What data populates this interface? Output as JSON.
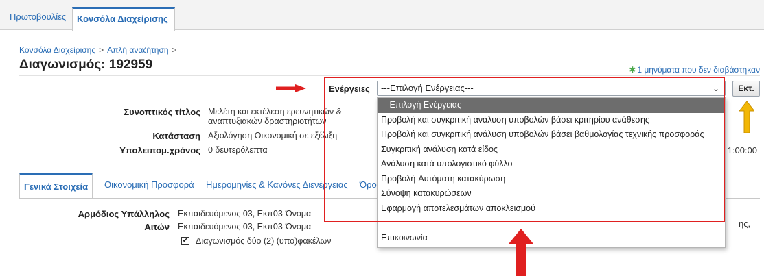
{
  "top_tabs": [
    "Πρωτοβουλίες",
    "Κονσόλα Διαχείρισης"
  ],
  "breadcrumb": [
    "Κονσόλα Διαχείρισης",
    "Απλή αναζήτηση"
  ],
  "breadcrumb_sep": ">",
  "page_title": "Διαγωνισμός: 192959",
  "messages_link": "1 μηνύματα που δεν διαβάστηκαν",
  "actions": {
    "label": "Ενέργειες",
    "selected": "---Επιλογή Ενέργειας---",
    "exec_button": "Εκτ.",
    "options": [
      "---Επιλογή Ενέργειας---",
      "Προβολή και συγκριτική ανάλυση υποβολών βάσει κριτηρίου ανάθεσης",
      "Προβολή και συγκριτική ανάλυση υποβολών βάσει βαθμολογίας τεχνικής προσφοράς",
      "Συγκριτική ανάλυση κατά είδος",
      "Ανάλυση κατά υπολογιστικό φύλλο",
      "Προβολή-Αυτόματη κατακύρωση",
      "Σύνοψη κατακυρώσεων",
      "Εφαρμογή αποτελεσμάτων αποκλεισμού",
      "--------------------",
      "Επικοινωνία"
    ]
  },
  "summary": {
    "title_label": "Συνοπτικός τίτλος",
    "title_value": "Μελέτη και εκτέλεση ερευνητικών & αναπτυξιακών δραστηριοτήτων",
    "status_label": "Κατάσταση",
    "status_value": "Αξιολόγηση Οικονομική σε εξέλιξη",
    "remaining_label": "Υπολειπομ.χρόνος",
    "remaining_value": "0 δευτερόλεπτα",
    "time_right": "11:00:00"
  },
  "tabs": [
    "Γενικά Στοιχεία",
    "Οικονομική Προσφορά",
    "Ημερομηνίες & Κανόνες Διενέργειας",
    "Όρο"
  ],
  "general": {
    "officer_label": "Αρμόδιος Υπάλληλος",
    "officer_value": "Εκπαιδευόμενος 03, Εκπ03-Όνομα",
    "requester_label": "Αιτών",
    "requester_value": "Εκπαιδευόμενος 03, Εκπ03-Όνομα",
    "checkbox_label": "Διαγωνισμός δύο (2) (υπο)φακέλων",
    "checkbox_mark": "✔",
    "trail_text": "ης,"
  },
  "colors": {
    "accent": "#2a6db5",
    "highlight_box": "#e02020",
    "arrow_red": "#e02020",
    "arrow_yellow": "#f2b705"
  }
}
